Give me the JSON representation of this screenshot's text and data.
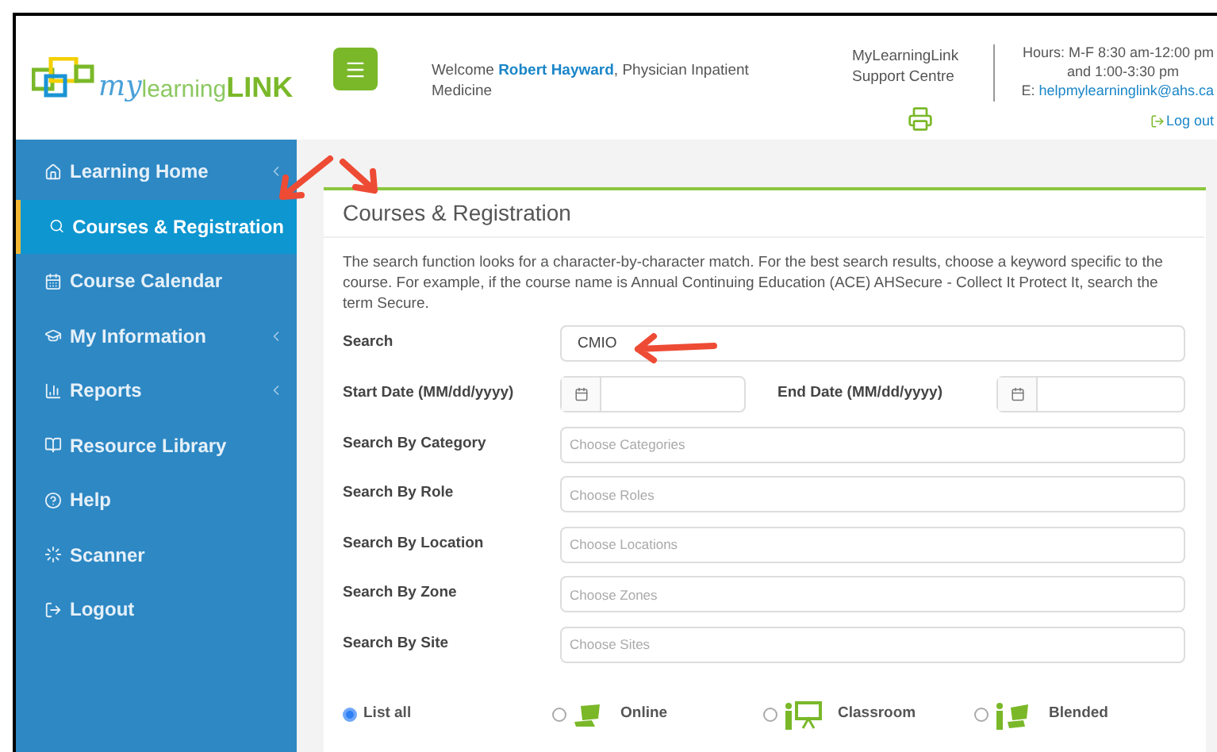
{
  "header": {
    "logo": {
      "part1": "my",
      "part2": "learning",
      "part3": "LINK"
    },
    "welcome": {
      "prefix": "Welcome ",
      "name": "Robert Hayward",
      "suffix": ", Physician Inpatient Medicine"
    },
    "support": "MyLearningLink Support Centre",
    "hours": [
      "Hours: M-F 8:30 am-12:00 pm",
      "and 1:00-3:30 pm"
    ],
    "email_prefix": "E: ",
    "email": "helpmylearninglink@ahs.ca",
    "logout": "Log out"
  },
  "sidebar": {
    "items": [
      {
        "label": "Learning Home",
        "selected": false,
        "expandable": true
      },
      {
        "label": "Courses & Registration",
        "selected": true,
        "expandable": false
      },
      {
        "label": "Course Calendar",
        "selected": false,
        "expandable": false
      },
      {
        "label": "My Information",
        "selected": false,
        "expandable": true
      },
      {
        "label": "Reports",
        "selected": false,
        "expandable": true
      },
      {
        "label": "Resource Library",
        "selected": false,
        "expandable": false
      },
      {
        "label": "Help",
        "selected": false,
        "expandable": false
      },
      {
        "label": "Scanner",
        "selected": false,
        "expandable": false
      },
      {
        "label": "Logout",
        "selected": false,
        "expandable": false
      }
    ]
  },
  "panel": {
    "title": "Courses & Registration",
    "description": "The search function looks for a character-by-character match. For the best search results, choose a keyword specific to the course. For example, if the course name is Annual Continuing Education (ACE) AHSecure - Collect It Protect It, search the term Secure.",
    "search": {
      "label": "Search",
      "value": "CMIO"
    },
    "start_date": {
      "label": "Start Date (MM/dd/yyyy)"
    },
    "end_date": {
      "label": "End Date (MM/dd/yyyy)"
    },
    "filters": [
      {
        "label": "Search By Category",
        "placeholder": "Choose Categories"
      },
      {
        "label": "Search By Role",
        "placeholder": "Choose Roles"
      },
      {
        "label": "Search By Location",
        "placeholder": "Choose Locations"
      },
      {
        "label": "Search By Zone",
        "placeholder": "Choose Zones"
      },
      {
        "label": "Search By Site",
        "placeholder": "Choose Sites"
      }
    ],
    "delivery": [
      {
        "label": "List all",
        "selected": true
      },
      {
        "label": "Online",
        "selected": false
      },
      {
        "label": "Classroom",
        "selected": false
      },
      {
        "label": "Blended",
        "selected": false
      }
    ]
  }
}
